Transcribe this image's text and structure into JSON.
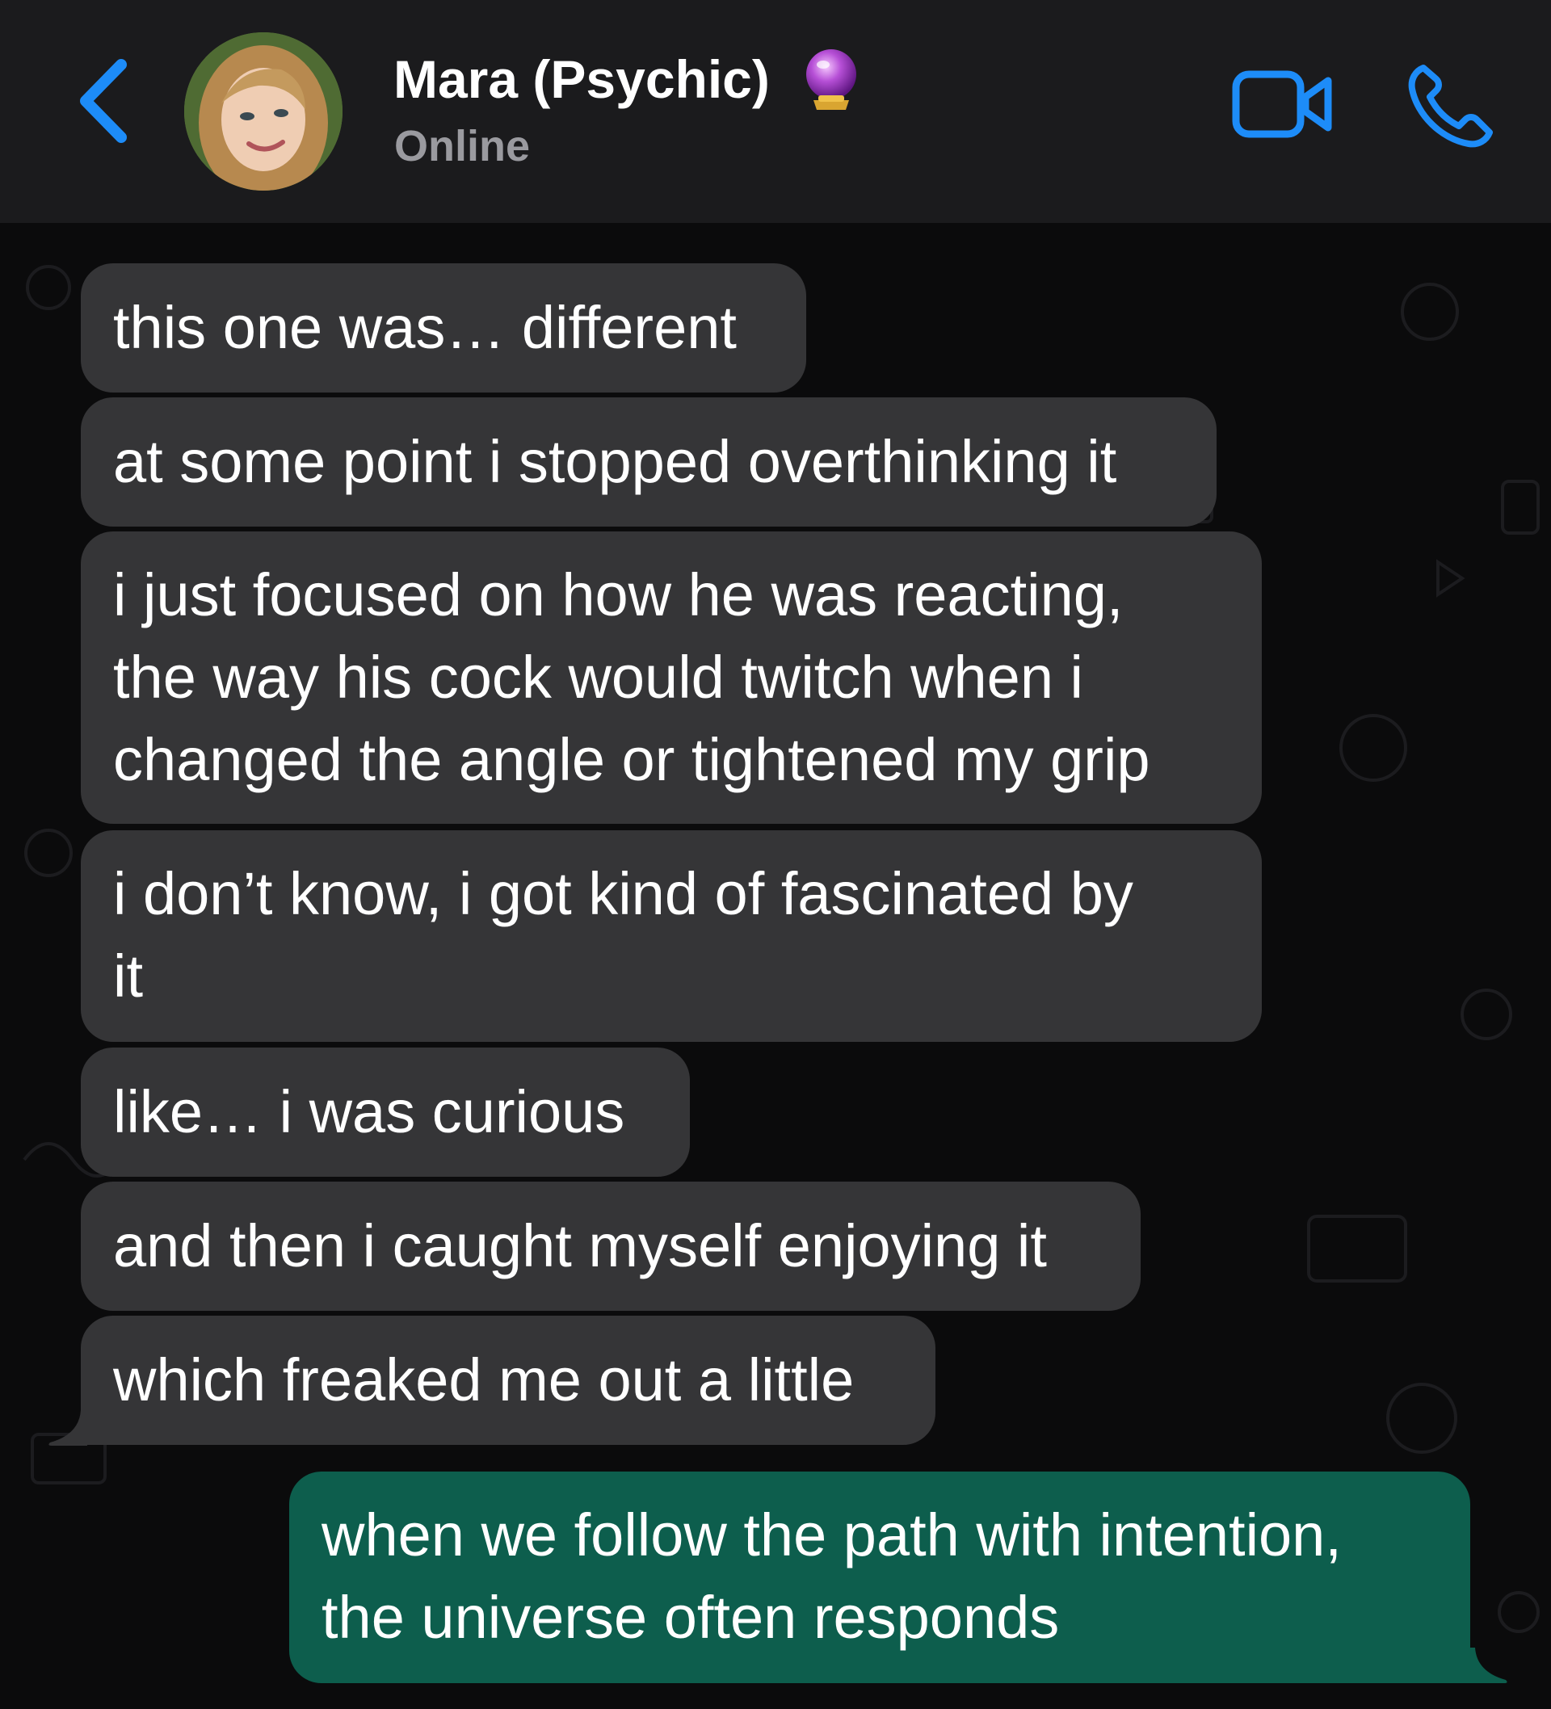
{
  "header": {
    "contact_name": "Mara (Psychic)",
    "status": "Online"
  },
  "icons": {
    "back": "back-chevron-icon",
    "video": "video-camera-icon",
    "call": "phone-icon",
    "emoji": "crystal-ball-icon"
  },
  "colors": {
    "accent": "#1d8cf8",
    "incoming_bubble": "#353537",
    "outgoing_bubble": "#0d5e4d",
    "header_bg": "#1b1b1d"
  },
  "messages": [
    {
      "direction": "incoming",
      "text": "this one was… different"
    },
    {
      "direction": "incoming",
      "text": "at some point i stopped overthinking it"
    },
    {
      "direction": "incoming",
      "text": "i just focused on how he was reacting,\nthe way his cock would twitch when i\nchanged the angle or tightened my grip"
    },
    {
      "direction": "incoming",
      "text": "i don’t know, i got kind of fascinated by\nit"
    },
    {
      "direction": "incoming",
      "text": "like… i was curious"
    },
    {
      "direction": "incoming",
      "text": "and then i caught myself enjoying it"
    },
    {
      "direction": "incoming",
      "text": "which freaked me out a little"
    },
    {
      "direction": "outgoing",
      "text": "when we follow the path with intention,\nthe universe often responds"
    }
  ]
}
